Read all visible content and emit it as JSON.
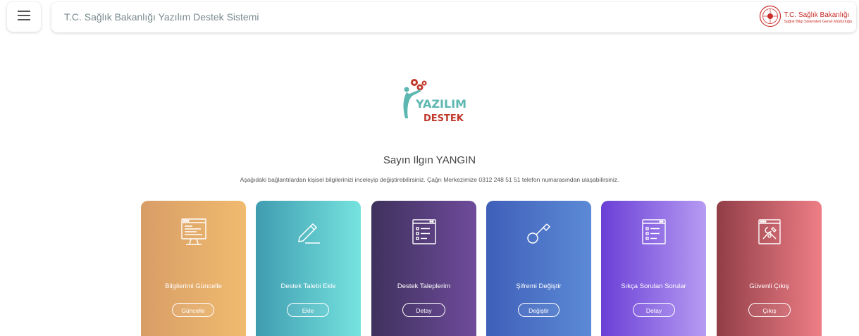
{
  "header": {
    "title": "T.C. Sağlık Bakanlığı Yazılım Destek Sistemi",
    "brand_name": "T.C. Sağlık Bakanlığı",
    "brand_sub": "Sağlık Bilgi Sistemleri Genel Müdürlüğü"
  },
  "logo": {
    "line1": "YAZILIM",
    "line2": "DESTEK"
  },
  "greeting": "Sayın Ilgın YANGIN",
  "info": "Aşağıdaki bağlantılardan kişisel bilgilerinizi inceleyip değiştirebilirsiniz. Çağrı Merkezimize 0312 248 51 51 telefon numarasından ulaşabilirsiniz.",
  "cards": [
    {
      "title": "Bilgilerimi Güncelle",
      "button": "Güncelle",
      "icon": "monitor-code-icon",
      "gradient": [
        "#d89d67",
        "#f0bb6f"
      ]
    },
    {
      "title": "Destek Talebi Ekle",
      "button": "Ekle",
      "icon": "pen-icon",
      "gradient": [
        "#3f9cb0",
        "#76e3df"
      ]
    },
    {
      "title": "Destek Taleplerim",
      "button": "Detay",
      "icon": "browser-list-icon",
      "gradient": [
        "#3f315d",
        "#6e4b9a"
      ]
    },
    {
      "title": "Şifremi Değiştir",
      "button": "Değiştir",
      "icon": "key-icon",
      "gradient": [
        "#3f5fb9",
        "#5c8ad6"
      ]
    },
    {
      "title": "Sıkça Sorulan Sorular",
      "button": "Detay",
      "icon": "browser-list-icon",
      "gradient": [
        "#6a3fd6",
        "#b69bf2"
      ]
    },
    {
      "title": "Güvenli Çıkış",
      "button": "Çıkış",
      "icon": "tools-icon",
      "gradient": [
        "#913e47",
        "#ee7e86"
      ]
    }
  ]
}
